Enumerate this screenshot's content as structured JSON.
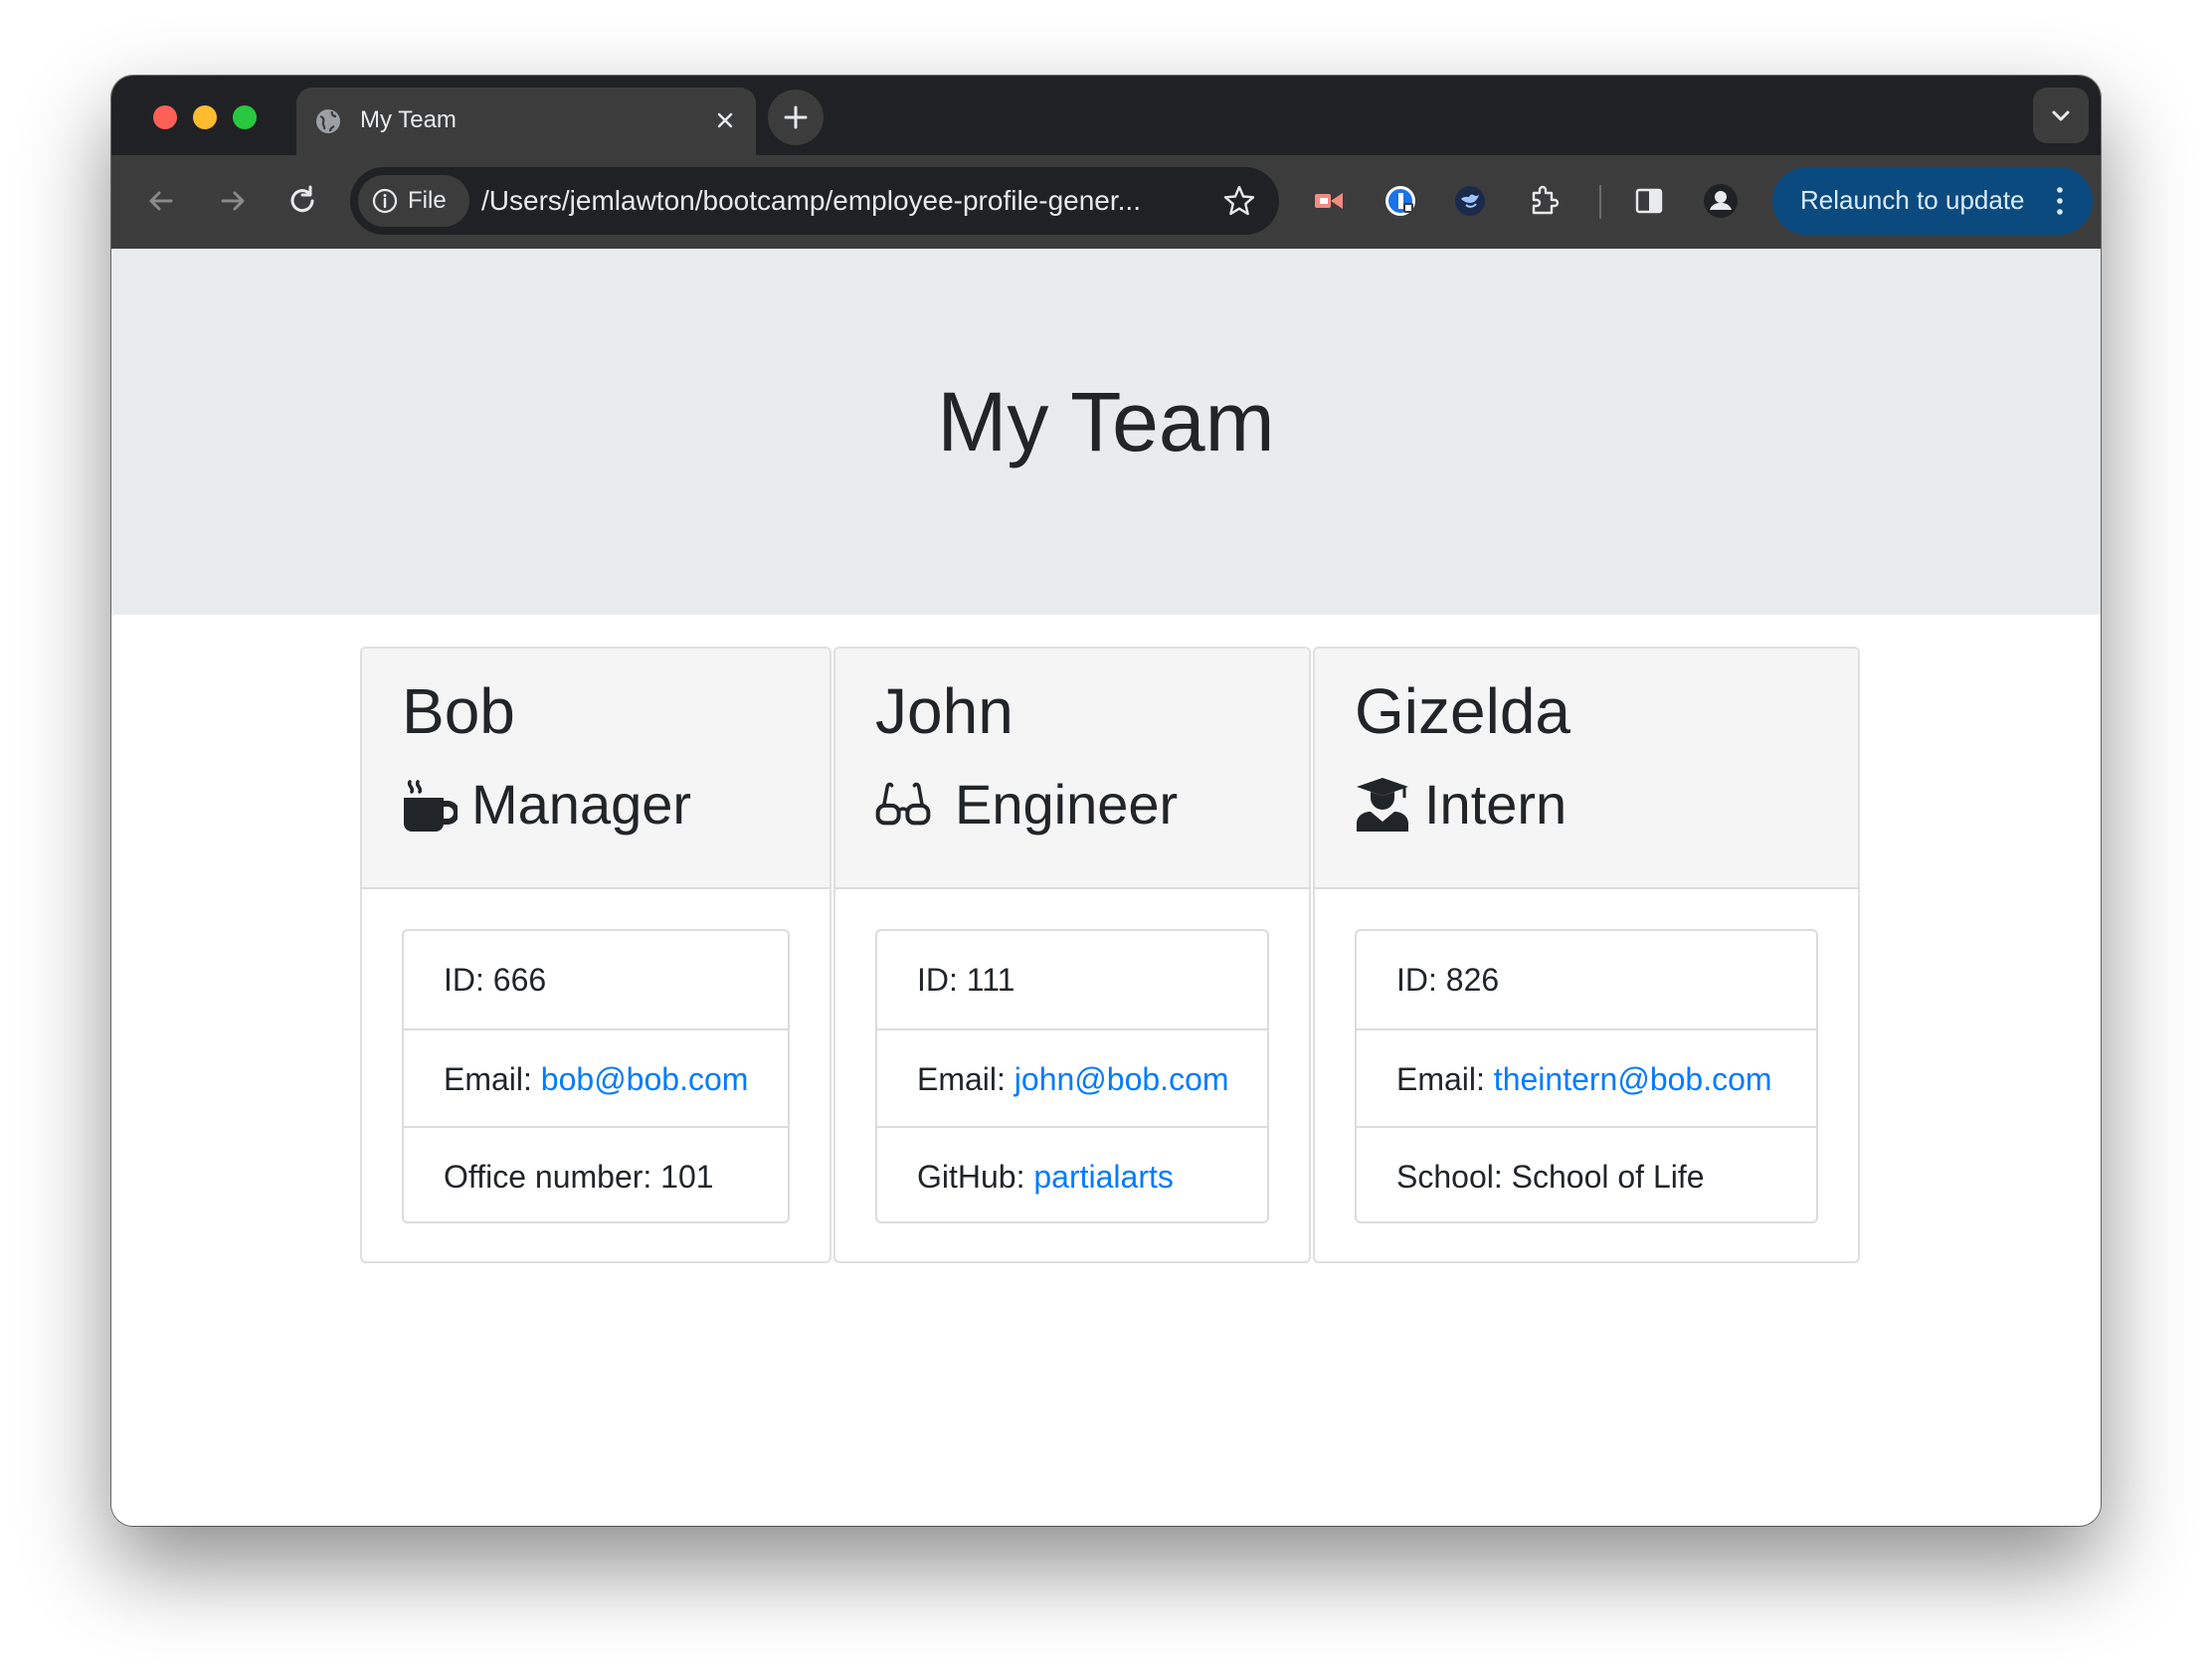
{
  "browser": {
    "tab_title": "My Team",
    "chip_label": "File",
    "url": "/Users/jemlawton/bootcamp/employee-profile-gener...",
    "relaunch_label": "Relaunch to update"
  },
  "page": {
    "title": "My Team",
    "link_color": "#007bff",
    "employees": [
      {
        "name": "Bob",
        "role": "Manager",
        "role_icon": "mug-hot-icon",
        "id_text": "ID: 666",
        "email_label": "Email: ",
        "email": "bob@bob.com",
        "extra_label": "Office number: 101",
        "extra_link": ""
      },
      {
        "name": "John",
        "role": "Engineer",
        "role_icon": "glasses-icon",
        "id_text": "ID: 111",
        "email_label": "Email: ",
        "email": "john@bob.com",
        "extra_label": "GitHub: ",
        "extra_link": "partialarts"
      },
      {
        "name": "Gizelda",
        "role": "Intern",
        "role_icon": "user-graduate-icon",
        "id_text": "ID: 826",
        "email_label": "Email: ",
        "email": "theintern@bob.com",
        "extra_label": "School: School of Life",
        "extra_link": ""
      }
    ]
  }
}
